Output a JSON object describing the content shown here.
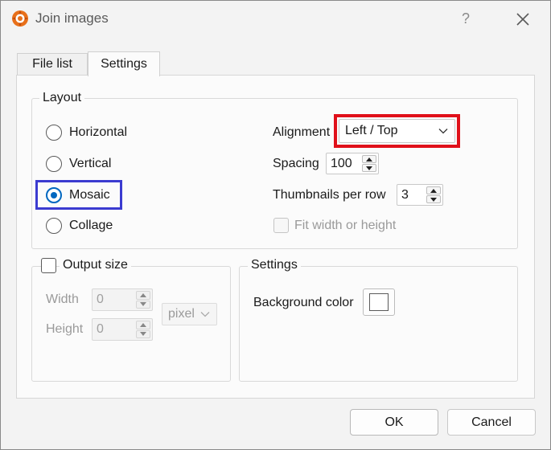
{
  "window": {
    "title": "Join images",
    "help": "?"
  },
  "tabs": [
    {
      "label": "File list",
      "active": false
    },
    {
      "label": "Settings",
      "active": true
    }
  ],
  "layout": {
    "group_title": "Layout",
    "options": [
      {
        "label": "Horizontal",
        "checked": false
      },
      {
        "label": "Vertical",
        "checked": false
      },
      {
        "label": "Mosaic",
        "checked": true
      },
      {
        "label": "Collage",
        "checked": false
      }
    ],
    "alignment_label": "Alignment",
    "alignment_value": "Left / Top",
    "spacing_label": "Spacing",
    "spacing_value": "100",
    "thumbs_label": "Thumbnails per row",
    "thumbs_value": "3",
    "fit_label": "Fit width or height"
  },
  "output": {
    "group_title": "Output size",
    "width_label": "Width",
    "width_value": "0",
    "height_label": "Height",
    "height_value": "0",
    "unit": "pixel"
  },
  "settings": {
    "group_title": "Settings",
    "bg_label": "Background color"
  },
  "buttons": {
    "ok": "OK",
    "cancel": "Cancel"
  },
  "colors": {
    "accent": "#0067c0",
    "highlight_red": "#e0101a",
    "highlight_blue": "#3b3bd0"
  }
}
